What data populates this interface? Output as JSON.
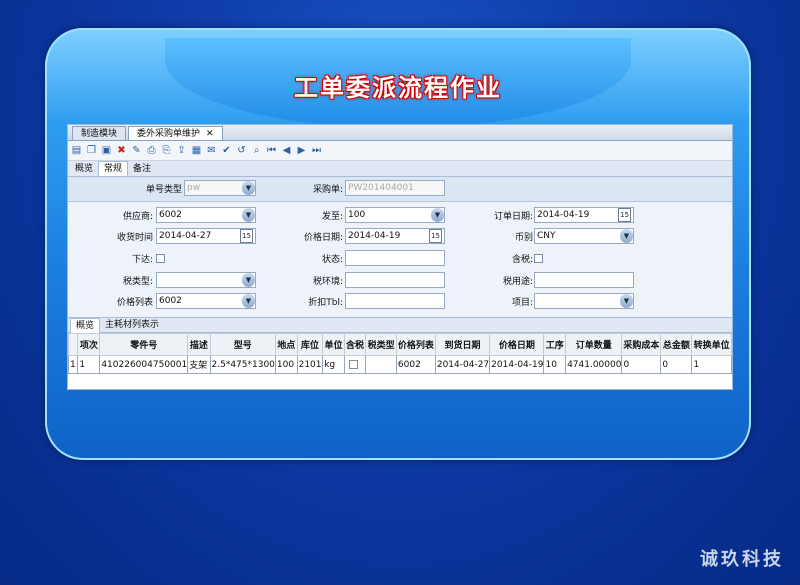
{
  "banner_title": "工单委派流程作业",
  "tabs": [
    {
      "label": "制造模块",
      "active": false
    },
    {
      "label": "委外采购单维护",
      "active": true,
      "close": "✕"
    }
  ],
  "toolbar_icons": [
    "new-doc-icon",
    "copy-icon",
    "save-icon",
    "delete-icon",
    "edit-icon",
    "print-preview-icon",
    "print-icon",
    "export-icon",
    "calendar-icon",
    "attachment-icon",
    "audit-icon",
    "unaudit-icon",
    "find-icon",
    "first-icon",
    "prev-icon",
    "next-icon",
    "last-icon"
  ],
  "subtabs": [
    "概览",
    "常规",
    "备注"
  ],
  "form": {
    "doc_type_label": "单号类型",
    "doc_type_value": "pw",
    "po_label": "采购单:",
    "po_value": "PW201404001",
    "supplier_label": "供应商:",
    "supplier_value": "6002",
    "ship_to_label": "发至:",
    "ship_to_value": "100",
    "order_date_label": "订单日期:",
    "order_date_value": "2014-04-19",
    "receive_time_label": "收货时间",
    "receive_time_value": "2014-04-27",
    "price_date_label": "价格日期:",
    "price_date_value": "2014-04-19",
    "currency_label": "币别",
    "currency_value": "CNY",
    "issued_label": "下达:",
    "status_label": "状态:",
    "status_value": "",
    "tax_incl_label": "含税:",
    "tax_type_label": "税类型:",
    "tax_type_value": "",
    "tax_env_label": "税环境:",
    "tax_env_value": "",
    "tax_use_label": "税用途:",
    "tax_use_value": "",
    "price_list_label": "价格列表",
    "price_list_value": "6002",
    "discount_label": "折扣Tbl:",
    "discount_value": "",
    "project_label": "项目:",
    "project_value": "",
    "calendar_day": "15"
  },
  "grid_tabs": [
    "概览",
    "主耗材列表示"
  ],
  "grid": {
    "columns": [
      "项次",
      "零件号",
      "描述",
      "型号",
      "地点",
      "库位",
      "单位",
      "含税",
      "税类型",
      "价格列表",
      "到货日期",
      "价格日期",
      "工序",
      "订单数量",
      "采购成本",
      "总金额",
      "转换单位"
    ],
    "rows": [
      [
        "1",
        "410226004750001",
        "支架",
        "2.5*475*1300",
        "100",
        "2101",
        "kg",
        "",
        "",
        "6002",
        "2014-04-27",
        "2014-04-19",
        "10",
        "4741.00000",
        "0",
        "0",
        "1"
      ]
    ],
    "row_marker": "1"
  },
  "brand": "诚玖科技"
}
